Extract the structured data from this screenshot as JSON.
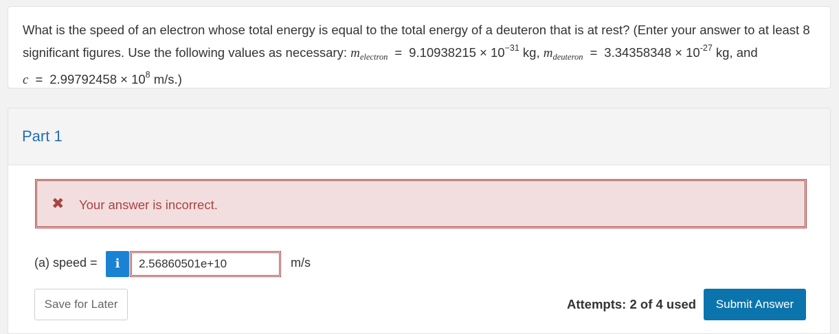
{
  "question": {
    "text_1": "What is the speed of an electron whose total energy is equal to the total energy of a deuteron that is at rest? (Enter your answer to at least 8 significant figures. Use the following values as necessary: ",
    "m_electron_var": "m",
    "m_electron_sub": "electron",
    "equals": "=",
    "m_electron_value": "9.10938215 × 10",
    "m_electron_exp": "−31",
    "m_electron_unit": " kg, ",
    "m_deuteron_var": "m",
    "m_deuteron_sub": "deuteron",
    "m_deuteron_value": "3.34358348 × 10",
    "m_deuteron_exp": "-27",
    "m_deuteron_unit": " kg, and ",
    "c_var": "c",
    "c_value": "2.99792458 × 10",
    "c_exp": "8",
    "c_unit": " m/s.)"
  },
  "part": {
    "title": "Part 1",
    "alert": {
      "icon": "close-icon",
      "text": "Your answer is incorrect.",
      "color": "#a94442",
      "background": "#f2dede"
    },
    "answer": {
      "label": "(a) speed =",
      "info_icon": "i",
      "value": "2.56860501e+10",
      "unit": "m/s"
    },
    "save_label": "Save for Later",
    "attempts": "Attempts: 2 of 4 used",
    "submit_label": "Submit Answer"
  },
  "colors": {
    "accent": "#1f6fb4",
    "submit": "#0b74ac",
    "info": "#1a82d3"
  }
}
